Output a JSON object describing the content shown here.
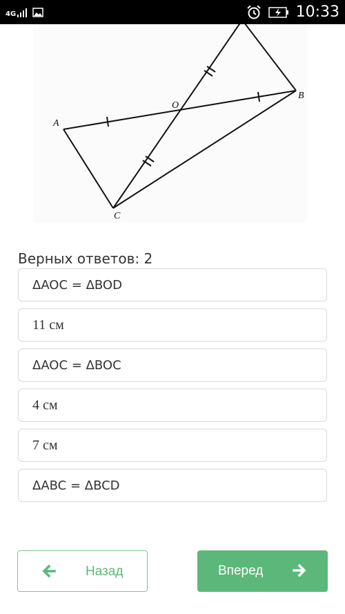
{
  "status_bar": {
    "network": "4G",
    "time": "10:33",
    "icons": [
      "signal-icon",
      "image-notification-icon",
      "alarm-icon",
      "battery-charging-icon"
    ]
  },
  "figure": {
    "points": [
      "A",
      "B",
      "C",
      "O"
    ]
  },
  "answers_heading": "Верных ответов: 2",
  "options": [
    {
      "label": "ΔAOC = ΔBOD"
    },
    {
      "label": "11 см"
    },
    {
      "label": "ΔAOC = ΔBOC"
    },
    {
      "label": "4 см"
    },
    {
      "label": "7 см"
    },
    {
      "label": "ΔABC = ΔBCD"
    }
  ],
  "nav": {
    "back_label": "Назад",
    "next_label": "Вперед"
  },
  "colors": {
    "accent": "#5cb77a",
    "status_bar": "#000000"
  }
}
